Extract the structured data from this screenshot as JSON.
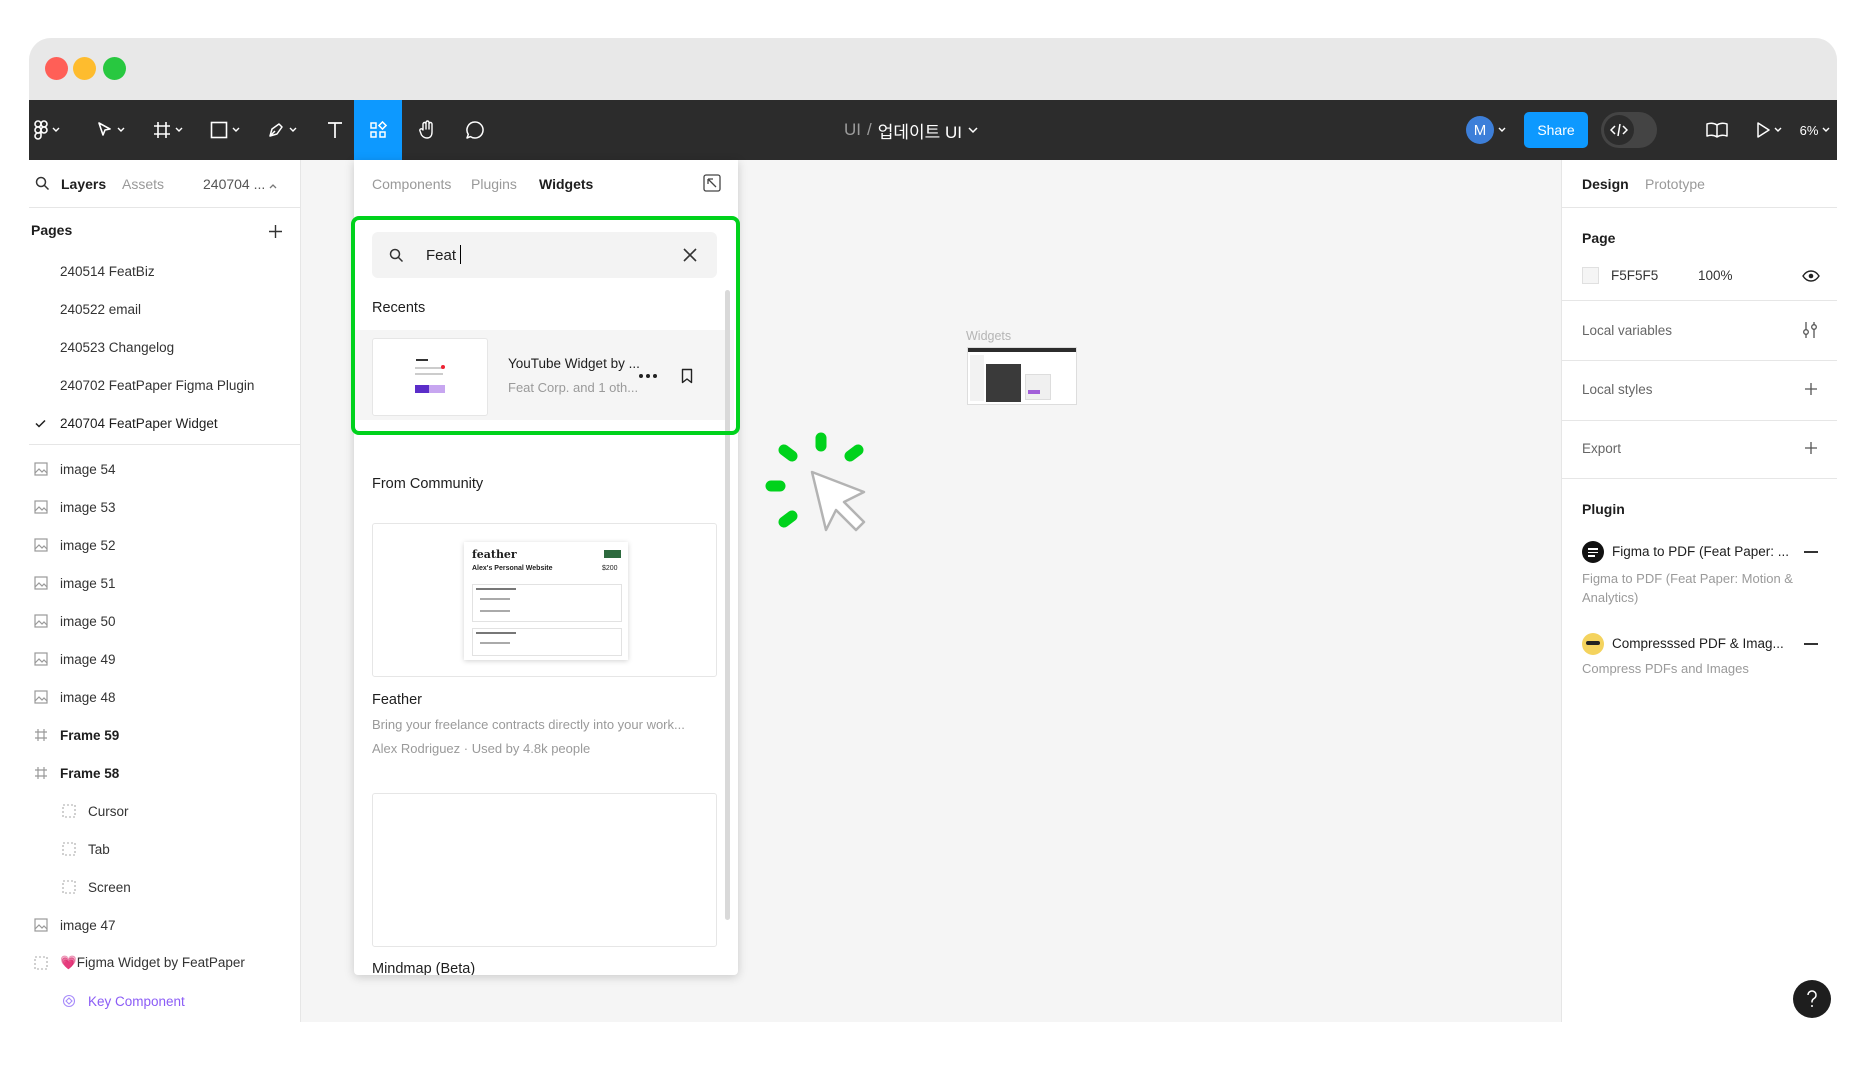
{
  "toolbar": {
    "breadcrumb_project": "UI",
    "breadcrumb_sep": "/",
    "file_name": "업데이트 UI",
    "avatar_letter": "M",
    "share_label": "Share",
    "zoom": "6%"
  },
  "left_panel": {
    "tabs": {
      "layers": "Layers",
      "assets": "Assets",
      "page_selector": "240704 ..."
    },
    "pages_title": "Pages",
    "pages": [
      {
        "label": "240514 FeatBiz"
      },
      {
        "label": "240522 email"
      },
      {
        "label": "240523 Changelog"
      },
      {
        "label": "240702 FeatPaper Figma Plugin"
      },
      {
        "label": "240704 FeatPaper Widget"
      }
    ],
    "layers": [
      {
        "label": "image 54"
      },
      {
        "label": "image 53"
      },
      {
        "label": "image 52"
      },
      {
        "label": "image 51"
      },
      {
        "label": "image 50"
      },
      {
        "label": "image 49"
      },
      {
        "label": "image 48"
      },
      {
        "label": "Frame 59"
      },
      {
        "label": "Frame 58"
      },
      {
        "label": "Cursor"
      },
      {
        "label": "Tab"
      },
      {
        "label": "Screen"
      },
      {
        "label": "image 47"
      },
      {
        "label": "💗Figma Widget by FeatPaper"
      },
      {
        "label": "Key Component"
      }
    ]
  },
  "widgets_panel": {
    "tabs": {
      "components": "Components",
      "plugins": "Plugins",
      "widgets": "Widgets"
    },
    "search": {
      "value": "Feat"
    },
    "recents_title": "Recents",
    "recent_item": {
      "title": "YouTube Widget by ...",
      "subtitle": "Feat Corp. and 1 oth..."
    },
    "community_title": "From Community",
    "community_items": [
      {
        "title": "Feather",
        "description": "Bring your freelance contracts directly into your work...",
        "meta": "Alex Rodriguez · Used by 4.8k people",
        "preview": {
          "brand": "feather",
          "heading": "Alex's Personal Website",
          "price": "$200"
        }
      },
      {
        "title": "Mindmap (Beta)"
      }
    ]
  },
  "canvas": {
    "frame_label": "Widgets"
  },
  "right_panel": {
    "tabs": {
      "design": "Design",
      "prototype": "Prototype"
    },
    "page_section": {
      "title": "Page",
      "color": "F5F5F5",
      "opacity": "100%"
    },
    "local_variables": "Local variables",
    "local_styles": "Local styles",
    "export": "Export",
    "plugin_title": "Plugin",
    "plugins": [
      {
        "name": "Figma to PDF (Feat Paper: ...",
        "description": "Figma to PDF (Feat Paper: Motion & Analytics)"
      },
      {
        "name": "Compresssed PDF & Imag...",
        "description": "Compress PDFs and Images"
      }
    ]
  },
  "colors": {
    "accent": "#0d99ff",
    "highlight": "#00d21c",
    "toolbar_bg": "#2c2c2c",
    "canvas_bg": "#f5f5f5"
  }
}
